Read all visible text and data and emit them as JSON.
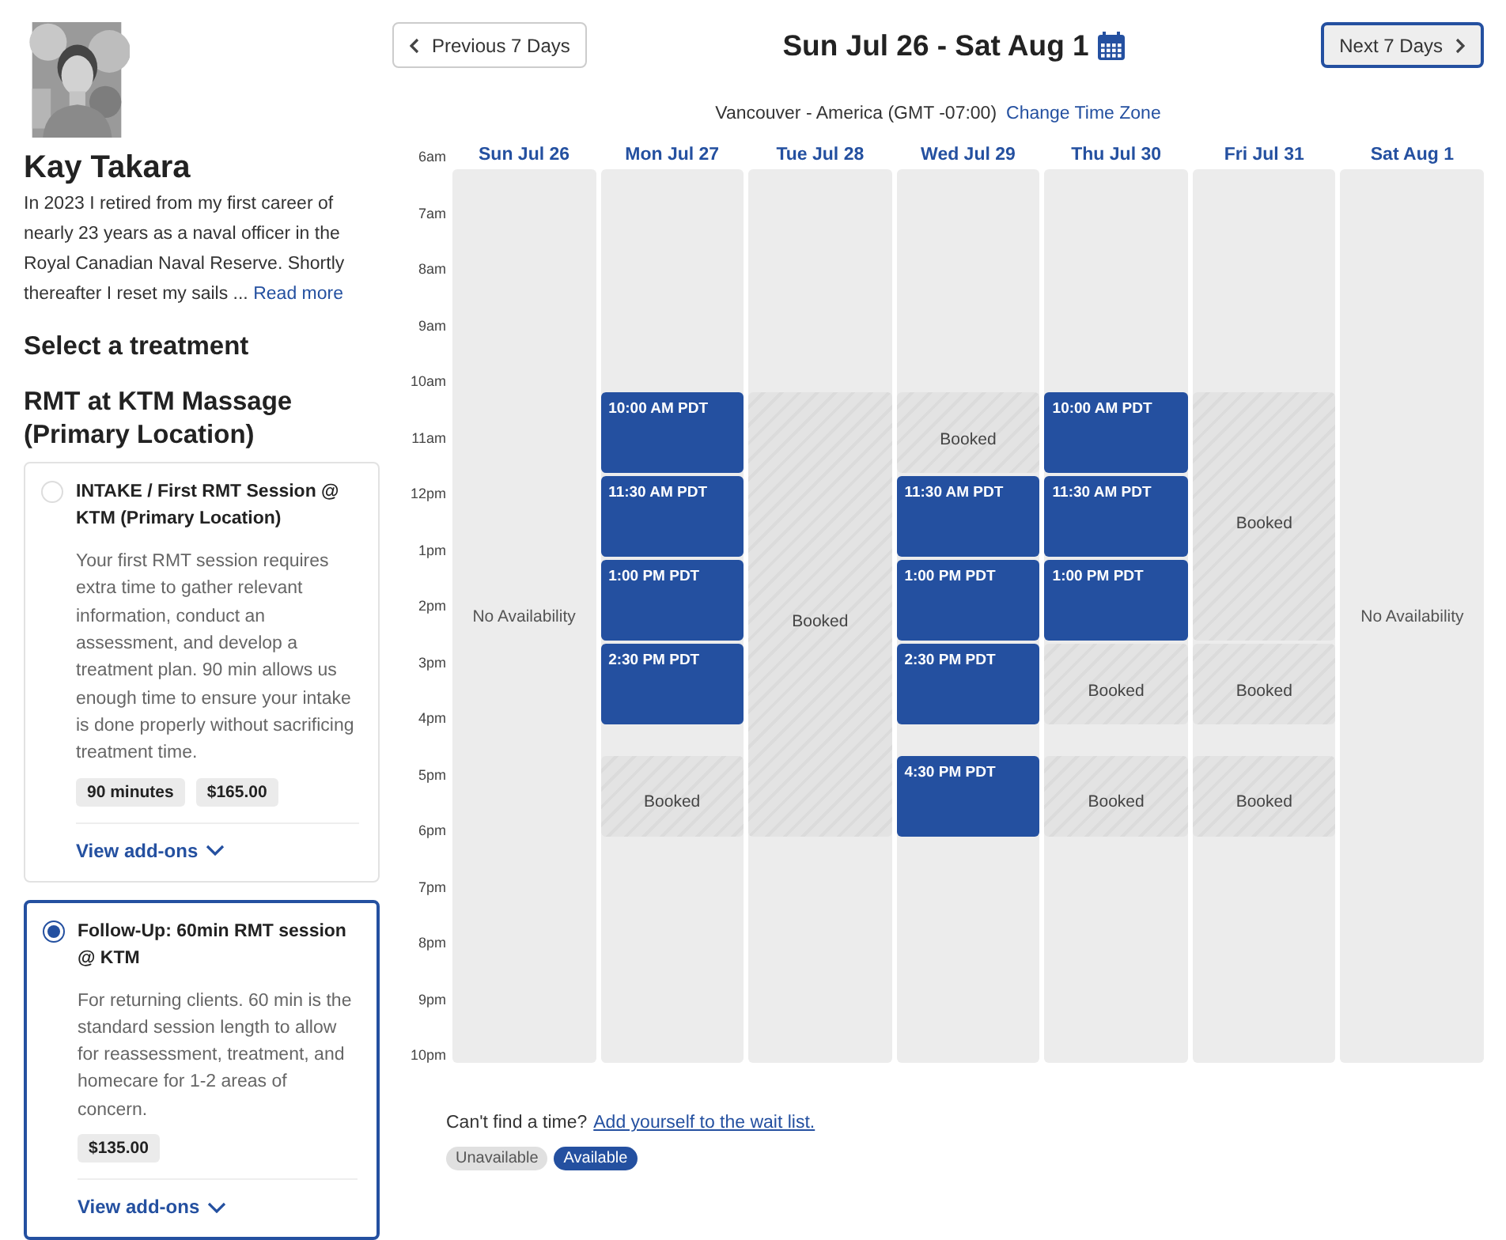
{
  "profile": {
    "name": "Kay Takara",
    "bio": "In 2023 I retired from my first career of nearly 23 years as a naval officer in the Royal Canadian Naval Reserve. Shortly thereafter I reset my sails ...",
    "read_more": "Read more"
  },
  "section_title": "Select a treatment",
  "location": "RMT at KTM Massage (Primary Location)",
  "treatments": [
    {
      "title": "INTAKE / First RMT Session @ KTM (Primary Location)",
      "description": "Your first RMT session requires extra time to gather relevant information, conduct an assessment, and develop a treatment plan. 90 min allows us enough time to ensure your intake is done properly without sacrificing treatment time.",
      "tags": [
        "90 minutes",
        "$165.00"
      ],
      "addons": "View add-ons",
      "selected": false
    },
    {
      "title": "Follow-Up: 60min RMT session @ KTM",
      "description": "For returning clients. 60 min is the standard session length to allow for reassessment, treatment, and homecare for 1-2 areas of concern.",
      "tags": [
        "$135.00"
      ],
      "addons": "View add-ons",
      "selected": true
    }
  ],
  "nav": {
    "previous": "Previous 7 Days",
    "range": "Sun Jul 26 - Sat Aug 1",
    "next": "Next 7 Days",
    "next_focused": true
  },
  "timezone": {
    "label": "Vancouver - America (GMT -07:00)",
    "link": "Change Time Zone"
  },
  "hours": [
    "6am",
    "7am",
    "8am",
    "9am",
    "10am",
    "11am",
    "12pm",
    "1pm",
    "2pm",
    "3pm",
    "4pm",
    "5pm",
    "6pm",
    "7pm",
    "8pm",
    "9pm",
    "10pm"
  ],
  "days": [
    {
      "label": "Sun Jul 26",
      "note": "No Availability"
    },
    {
      "label": "Mon Jul 27",
      "cells": [
        {
          "kind": "free"
        },
        {
          "kind": "free"
        },
        {
          "kind": "free"
        },
        {
          "kind": "free"
        },
        {
          "kind": "free"
        },
        {
          "kind": "free"
        },
        {
          "kind": "free"
        },
        {
          "kind": "free"
        },
        {
          "kind": "available",
          "label": "10:00 AM PDT"
        },
        {
          "kind": "cont"
        },
        {
          "kind": "cont"
        },
        {
          "kind": "available",
          "label": "11:30 AM PDT"
        },
        {
          "kind": "cont"
        },
        {
          "kind": "cont"
        },
        {
          "kind": "available",
          "label": "1:00 PM PDT"
        },
        {
          "kind": "cont"
        },
        {
          "kind": "cont"
        },
        {
          "kind": "available",
          "label": "2:30 PM PDT"
        },
        {
          "kind": "cont"
        },
        {
          "kind": "cont"
        },
        {
          "kind": "free"
        },
        {
          "kind": "booked",
          "label": "Booked"
        },
        {
          "kind": "cont"
        },
        {
          "kind": "cont"
        }
      ]
    },
    {
      "label": "Tue Jul 28",
      "cells": [
        {
          "kind": "free"
        },
        {
          "kind": "free"
        },
        {
          "kind": "free"
        },
        {
          "kind": "free"
        },
        {
          "kind": "free"
        },
        {
          "kind": "free"
        },
        {
          "kind": "free"
        },
        {
          "kind": "free"
        },
        {
          "kind": "booked",
          "label": "Booked"
        },
        {
          "kind": "cont"
        },
        {
          "kind": "cont"
        },
        {
          "kind": "cont"
        },
        {
          "kind": "cont"
        },
        {
          "kind": "cont"
        },
        {
          "kind": "cont"
        },
        {
          "kind": "cont"
        },
        {
          "kind": "cont"
        },
        {
          "kind": "cont"
        },
        {
          "kind": "cont"
        },
        {
          "kind": "cont"
        },
        {
          "kind": "cont"
        },
        {
          "kind": "cont"
        },
        {
          "kind": "cont"
        },
        {
          "kind": "cont"
        }
      ]
    },
    {
      "label": "Wed Jul 29",
      "cells": [
        {
          "kind": "free"
        },
        {
          "kind": "free"
        },
        {
          "kind": "free"
        },
        {
          "kind": "free"
        },
        {
          "kind": "free"
        },
        {
          "kind": "free"
        },
        {
          "kind": "free"
        },
        {
          "kind": "free"
        },
        {
          "kind": "booked",
          "label": "Booked"
        },
        {
          "kind": "cont"
        },
        {
          "kind": "cont"
        },
        {
          "kind": "available",
          "label": "11:30 AM PDT"
        },
        {
          "kind": "cont"
        },
        {
          "kind": "cont"
        },
        {
          "kind": "available",
          "label": "1:00 PM PDT"
        },
        {
          "kind": "cont"
        },
        {
          "kind": "cont"
        },
        {
          "kind": "available",
          "label": "2:30 PM PDT"
        },
        {
          "kind": "cont"
        },
        {
          "kind": "cont"
        },
        {
          "kind": "free"
        },
        {
          "kind": "available",
          "label": "4:30 PM PDT"
        },
        {
          "kind": "cont"
        },
        {
          "kind": "cont"
        }
      ]
    },
    {
      "label": "Thu Jul 30",
      "cells": [
        {
          "kind": "free"
        },
        {
          "kind": "free"
        },
        {
          "kind": "free"
        },
        {
          "kind": "free"
        },
        {
          "kind": "free"
        },
        {
          "kind": "free"
        },
        {
          "kind": "free"
        },
        {
          "kind": "free"
        },
        {
          "kind": "available",
          "label": "10:00 AM PDT"
        },
        {
          "kind": "cont"
        },
        {
          "kind": "cont"
        },
        {
          "kind": "available",
          "label": "11:30 AM PDT"
        },
        {
          "kind": "cont"
        },
        {
          "kind": "cont"
        },
        {
          "kind": "available",
          "label": "1:00 PM PDT"
        },
        {
          "kind": "cont"
        },
        {
          "kind": "cont"
        },
        {
          "kind": "booked",
          "label": "Booked"
        },
        {
          "kind": "cont"
        },
        {
          "kind": "cont"
        },
        {
          "kind": "free"
        },
        {
          "kind": "booked",
          "label": "Booked"
        },
        {
          "kind": "cont"
        },
        {
          "kind": "cont"
        }
      ]
    },
    {
      "label": "Fri Jul 31",
      "cells": [
        {
          "kind": "free"
        },
        {
          "kind": "free"
        },
        {
          "kind": "free"
        },
        {
          "kind": "free"
        },
        {
          "kind": "free"
        },
        {
          "kind": "free"
        },
        {
          "kind": "free"
        },
        {
          "kind": "free"
        },
        {
          "kind": "booked",
          "label": "Booked"
        },
        {
          "kind": "cont"
        },
        {
          "kind": "cont"
        },
        {
          "kind": "cont"
        },
        {
          "kind": "cont"
        },
        {
          "kind": "cont"
        },
        {
          "kind": "cont"
        },
        {
          "kind": "cont"
        },
        {
          "kind": "cont"
        },
        {
          "kind": "booked",
          "label": "Booked"
        },
        {
          "kind": "cont"
        },
        {
          "kind": "cont"
        },
        {
          "kind": "free"
        },
        {
          "kind": "booked",
          "label": "Booked"
        },
        {
          "kind": "cont"
        },
        {
          "kind": "cont"
        }
      ]
    },
    {
      "label": "Sat Aug 1",
      "note": "No Availability"
    }
  ],
  "footer": {
    "prompt": "Can't find a time?",
    "link": "Add yourself to the wait list."
  },
  "legend": [
    {
      "label": "Unavailable",
      "kind": "unavailable"
    },
    {
      "label": "Available",
      "kind": "available"
    }
  ]
}
